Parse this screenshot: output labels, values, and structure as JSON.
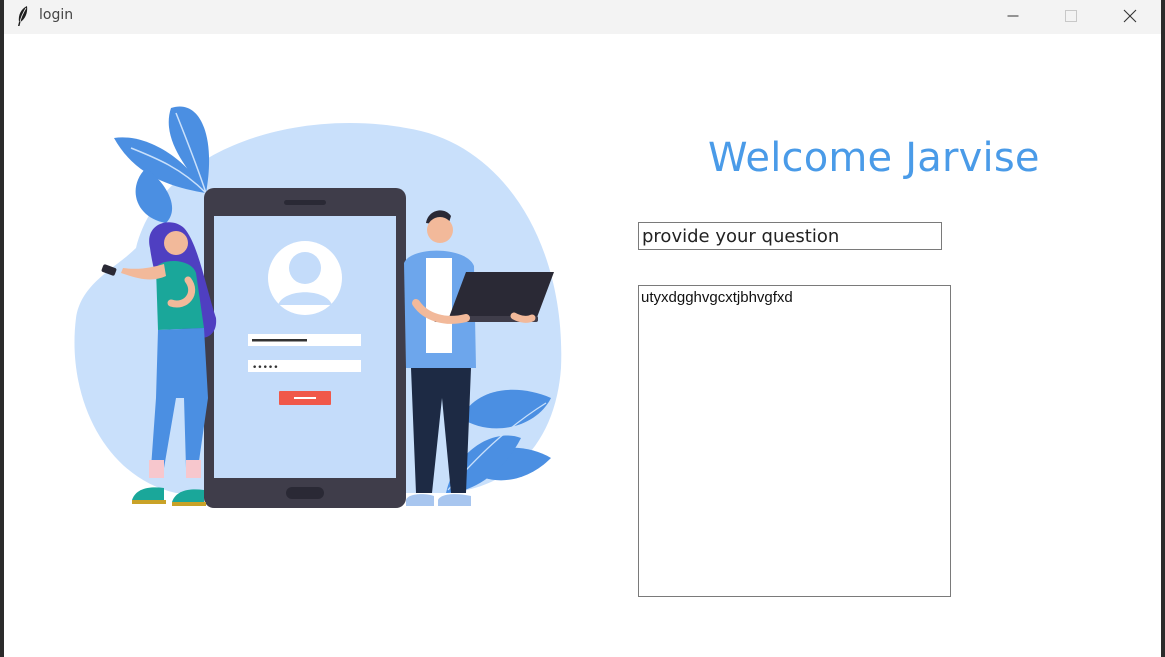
{
  "window": {
    "title": "login",
    "icons": {
      "app": "feather-icon",
      "minimize": "minimize-icon",
      "maximize": "maximize-icon",
      "close": "close-icon"
    }
  },
  "main": {
    "welcome_text": "Welcome Jarvise",
    "question_input": {
      "value": "provide your question",
      "placeholder": ""
    },
    "answer_box": {
      "value": "utyxdgghvgcxtjbhvgfxd"
    },
    "illustration": {
      "description_icon": "login-illustration",
      "password_mask": "•••••"
    }
  },
  "colors": {
    "accent": "#4a9be8",
    "blob": "#c9e0fb",
    "leaf": "#4b8fe2",
    "phone_frame": "#3f3d4a",
    "phone_screen": "#c4dcfa",
    "login_button": "#f0584a"
  }
}
